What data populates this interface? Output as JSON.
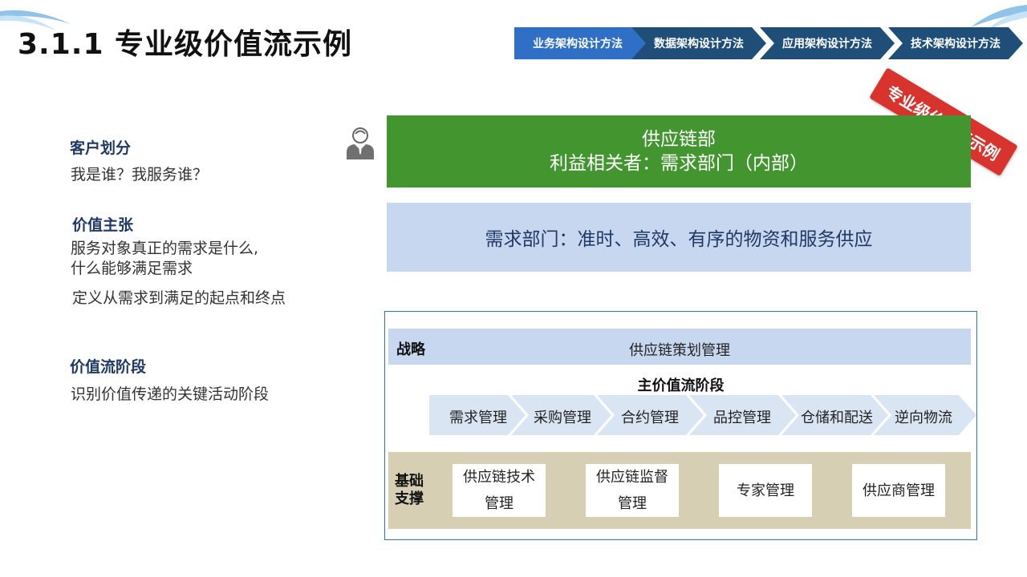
{
  "page": {
    "title": "3.1.1 专业级价值流示例",
    "stamp": "专业级价值流示例"
  },
  "nav": {
    "tabs": [
      {
        "label": "业务架构设计方法",
        "active": true
      },
      {
        "label": "数据架构设计方法",
        "active": false
      },
      {
        "label": "应用架构设计方法",
        "active": false
      },
      {
        "label": "技术架构设计方法",
        "active": false
      }
    ]
  },
  "sidebar": {
    "customer_heading": "客户划分",
    "customer_text": "我是谁？我服务谁？",
    "value_heading": "价值主张",
    "value_text_1": "服务对象真正的需求是什么,",
    "value_text_2": "什么能够满足需求",
    "value_text_3": "定义从需求到满足的起点和终点",
    "stage_heading": "价值流阶段",
    "stage_text": "识别价值传递的关键活动阶段"
  },
  "banners": {
    "supply_line1": "供应链部",
    "supply_line2": "利益相关者：需求部门（内部）",
    "demand": "需求部门：准时、高效、有序的物资和服务供应"
  },
  "flow": {
    "strategy_label": "战略",
    "strategy_text": "供应链策划管理",
    "main_stage_title": "主价值流阶段",
    "stages": [
      "需求管理",
      "采购管理",
      "合约管理",
      "品控管理",
      "仓储和配送",
      "逆向物流"
    ],
    "support_label_1": "基础",
    "support_label_2": "支撑",
    "support": [
      "供应链技术管理",
      "供应链监督管理",
      "专家管理",
      "供应商管理"
    ]
  },
  "colors": {
    "tab_active": "#2f6fc5",
    "tab_inactive": "#1f4e79",
    "supply_green": "#43962f",
    "light_blue": "#c6d7ef",
    "chevron_blue": "#dae5f3",
    "support_tan": "#d6cfb4",
    "stamp_red": "#d8332d"
  },
  "icons": {
    "person": "person-icon"
  }
}
